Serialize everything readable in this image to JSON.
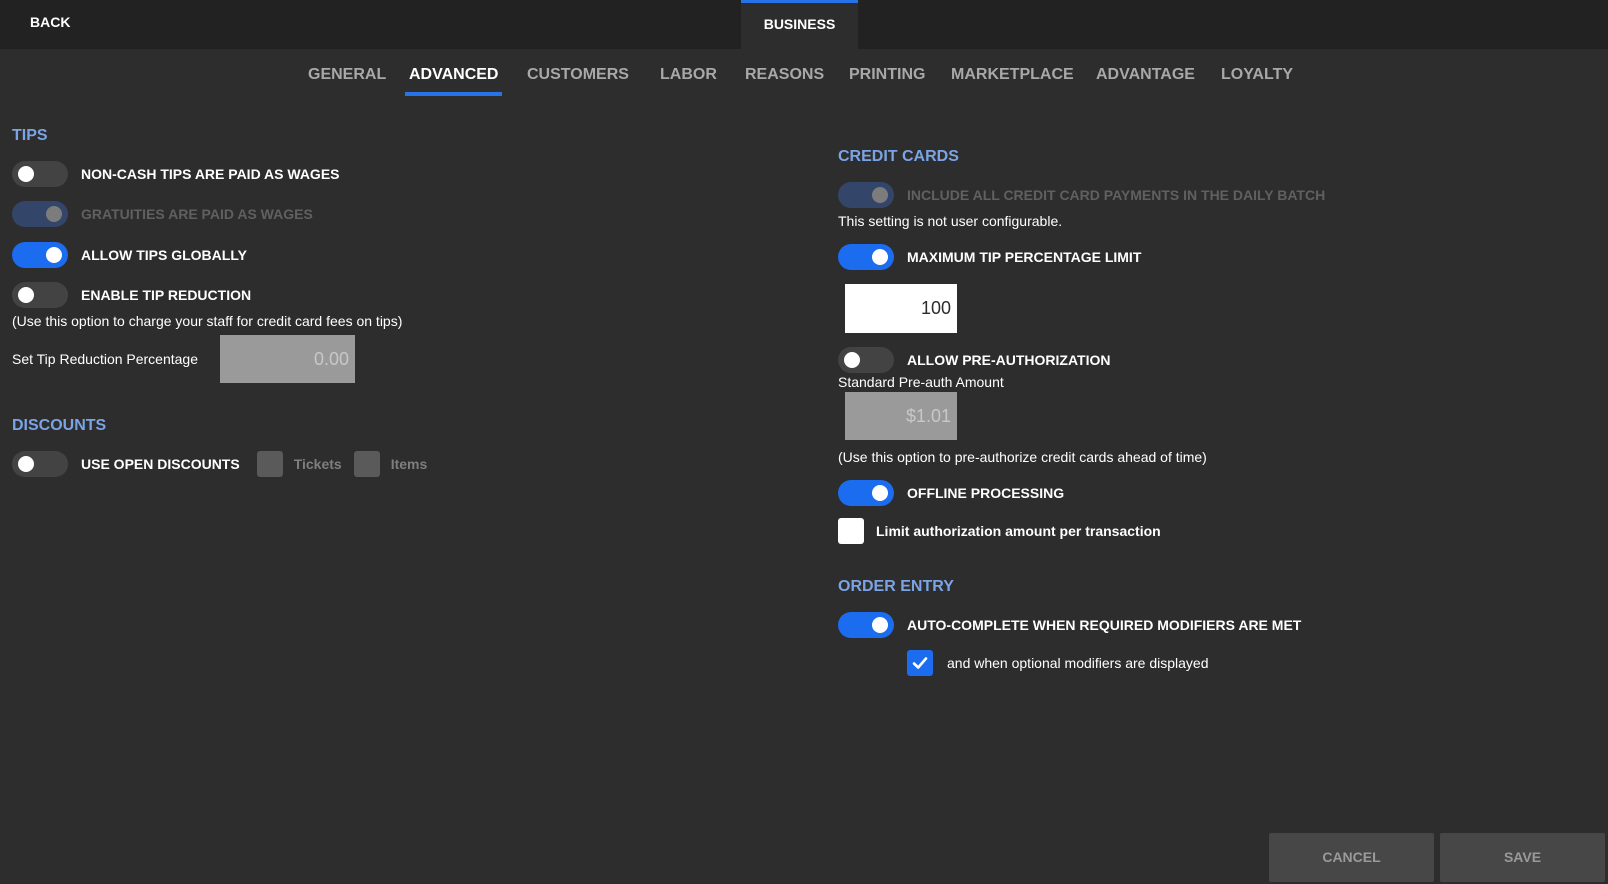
{
  "header": {
    "back_label": "BACK",
    "title": "BUSINESS"
  },
  "tabs": [
    {
      "label": "GENERAL",
      "active": false
    },
    {
      "label": "ADVANCED",
      "active": true
    },
    {
      "label": "CUSTOMERS",
      "active": false
    },
    {
      "label": "LABOR",
      "active": false
    },
    {
      "label": "REASONS",
      "active": false
    },
    {
      "label": "PRINTING",
      "active": false
    },
    {
      "label": "MARKETPLACE",
      "active": false
    },
    {
      "label": "ADVANTAGE",
      "active": false
    },
    {
      "label": "LOYALTY",
      "active": false
    }
  ],
  "tips": {
    "title": "TIPS",
    "non_cash_tips": {
      "label": "NON-CASH TIPS ARE PAID AS WAGES",
      "state": "off"
    },
    "gratuities": {
      "label": "GRATUITIES ARE PAID AS WAGES",
      "state": "disabled-on"
    },
    "allow_tips": {
      "label": "ALLOW TIPS GLOBALLY",
      "state": "on"
    },
    "tip_reduction": {
      "label": "ENABLE TIP REDUCTION",
      "state": "off"
    },
    "tip_reduction_note": "(Use this option to charge your staff for credit card fees on tips)",
    "tip_reduction_pct_label": "Set Tip Reduction Percentage",
    "tip_reduction_pct_value": "0.00"
  },
  "discounts": {
    "title": "DISCOUNTS",
    "open_discounts": {
      "label": "USE OPEN DISCOUNTS",
      "state": "off"
    },
    "tickets_label": "Tickets",
    "items_label": "Items"
  },
  "credit_cards": {
    "title": "CREDIT CARDS",
    "daily_batch": {
      "label": "INCLUDE ALL CREDIT CARD PAYMENTS IN THE DAILY BATCH",
      "state": "disabled-on"
    },
    "not_configurable_note": "This setting is not user configurable.",
    "max_tip": {
      "label": "MAXIMUM TIP PERCENTAGE LIMIT",
      "state": "on"
    },
    "max_tip_value": "100",
    "pre_auth": {
      "label": "ALLOW PRE-AUTHORIZATION",
      "state": "off"
    },
    "pre_auth_amount_label": "Standard Pre-auth Amount",
    "pre_auth_amount_value": "$1.01",
    "pre_auth_note": "(Use this option to pre-authorize credit cards ahead of time)",
    "offline": {
      "label": "OFFLINE PROCESSING",
      "state": "on"
    },
    "limit_auth_label": "Limit authorization amount per transaction",
    "limit_auth_checked": false
  },
  "order_entry": {
    "title": "ORDER ENTRY",
    "auto_complete": {
      "label": "AUTO-COMPLETE WHEN REQUIRED MODIFIERS ARE MET",
      "state": "on"
    },
    "optional_label": "and when optional modifiers are displayed",
    "optional_checked": true
  },
  "footer": {
    "cancel_label": "CANCEL",
    "save_label": "SAVE"
  },
  "colors": {
    "accent": "#1c6cf0",
    "section_title": "#7aa4e6",
    "background": "#2d2d2d"
  },
  "icons": {
    "checkmark": "check-icon"
  }
}
